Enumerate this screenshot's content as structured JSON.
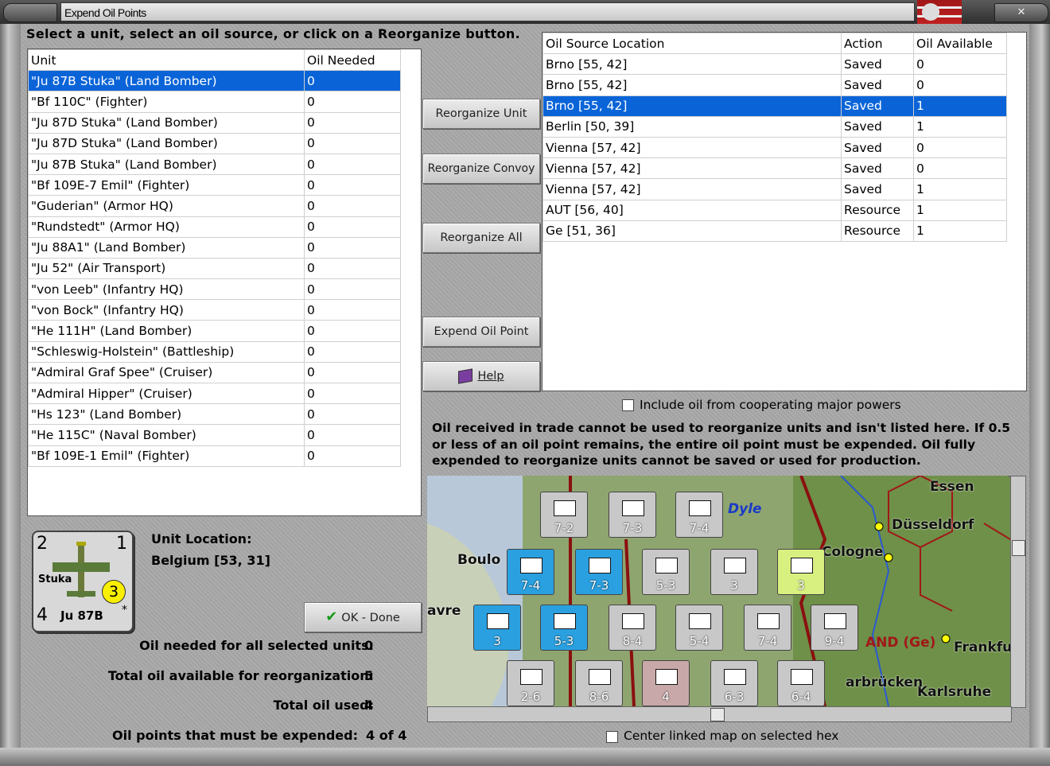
{
  "window": {
    "title": "Expend Oil Points"
  },
  "instruction": "Select a unit, select an oil source, or click on a Reorganize button.",
  "unit_table": {
    "columns": [
      "Unit",
      "Oil Needed"
    ],
    "rows": [
      {
        "unit": "\"Ju 87B Stuka\" (Land Bomber)",
        "oil": "0",
        "selected": true
      },
      {
        "unit": "\"Bf 110C\" (Fighter)",
        "oil": "0"
      },
      {
        "unit": "\"Ju 87D Stuka\" (Land Bomber)",
        "oil": "0"
      },
      {
        "unit": "\"Ju 87D Stuka\" (Land Bomber)",
        "oil": "0"
      },
      {
        "unit": "\"Ju 87B Stuka\" (Land Bomber)",
        "oil": "0"
      },
      {
        "unit": "\"Bf 109E-7 Emil\" (Fighter)",
        "oil": "0"
      },
      {
        "unit": "\"Guderian\" (Armor HQ)",
        "oil": "0"
      },
      {
        "unit": "\"Rundstedt\" (Armor HQ)",
        "oil": "0"
      },
      {
        "unit": "\"Ju 88A1\" (Land Bomber)",
        "oil": "0"
      },
      {
        "unit": "\"Ju 52\" (Air Transport)",
        "oil": "0"
      },
      {
        "unit": "\"von Leeb\" (Infantry HQ)",
        "oil": "0"
      },
      {
        "unit": "\"von Bock\" (Infantry HQ)",
        "oil": "0"
      },
      {
        "unit": "\"He 111H\" (Land Bomber)",
        "oil": "0"
      },
      {
        "unit": "\"Schleswig-Holstein\" (Battleship)",
        "oil": "0"
      },
      {
        "unit": "\"Admiral Graf Spee\" (Cruiser)",
        "oil": "0"
      },
      {
        "unit": "\"Admiral Hipper\" (Cruiser)",
        "oil": "0"
      },
      {
        "unit": "\"Hs 123\" (Land Bomber)",
        "oil": "0"
      },
      {
        "unit": "\"He 115C\" (Naval Bomber)",
        "oil": "0"
      },
      {
        "unit": "\"Bf 109E-1 Emil\" (Fighter)",
        "oil": "0"
      }
    ]
  },
  "oil_table": {
    "columns": [
      "Oil Source Location",
      "Action",
      "Oil Available"
    ],
    "rows": [
      {
        "location": "Brno [55, 42]",
        "action": "Saved",
        "available": "0"
      },
      {
        "location": "Brno [55, 42]",
        "action": "Saved",
        "available": "0"
      },
      {
        "location": "Brno [55, 42]",
        "action": "Saved",
        "available": "1",
        "selected": true
      },
      {
        "location": "Berlin [50, 39]",
        "action": "Saved",
        "available": "1"
      },
      {
        "location": "Vienna [57, 42]",
        "action": "Saved",
        "available": "0"
      },
      {
        "location": "Vienna [57, 42]",
        "action": "Saved",
        "available": "0"
      },
      {
        "location": "Vienna [57, 42]",
        "action": "Saved",
        "available": "1"
      },
      {
        "location": "AUT [56, 40]",
        "action": "Resource",
        "available": "1"
      },
      {
        "location": "Ge [51, 36]",
        "action": "Resource",
        "available": "1"
      }
    ]
  },
  "buttons": {
    "reorganize_unit": "Reorganize Unit",
    "reorganize_convoy": "Reorganize Convoy",
    "reorganize_all": "Reorganize All",
    "expend_oil_point": "Expend Oil Point",
    "help": "Help",
    "ok_done": "OK - Done"
  },
  "include_coop_label": "Include oil from cooperating major powers",
  "note": "Oil received in trade cannot be used to reorganize units and isn't listed here.  If 0.5 or less of an oil point remains, the entire oil point must be expended.  Oil fully expended to reorganize units cannot be saved or used for production.",
  "unit_counter": {
    "top_left": "2",
    "top_right": "1",
    "name": "Stuka",
    "circle": "3",
    "bottom_left": "4",
    "model": "Ju 87B",
    "star": "*"
  },
  "unit_location": {
    "label": "Unit Location:",
    "value": "Belgium [53, 31]"
  },
  "summary": [
    {
      "label": "Oil needed for all selected units:",
      "value": "0"
    },
    {
      "label": "Total oil available for reorganization:",
      "value": "5"
    },
    {
      "label": "Total oil used:",
      "value": "4"
    },
    {
      "label": "Oil points that must be expended:",
      "value": "4 of 4"
    }
  ],
  "map": {
    "cities": [
      "Essen",
      "Düsseldorf",
      "Cologne",
      "Frankfu",
      "Karlsruhe",
      "arbrücken",
      "Boulo",
      "avre"
    ],
    "region_label": "AND (Ge)",
    "river_label": "Dyle",
    "counters": [
      {
        "value": "7-2",
        "color": "#c8c8c8"
      },
      {
        "value": "7-3",
        "color": "#c8c8c8"
      },
      {
        "value": "7-4",
        "color": "#c8c8c8"
      },
      {
        "value": "7-4",
        "color": "#2aa0e0"
      },
      {
        "value": "7-3",
        "color": "#2aa0e0"
      },
      {
        "value": "5-3",
        "color": "#c8c8c8"
      },
      {
        "value": "3",
        "color": "#c8c8c8"
      },
      {
        "value": "3",
        "color": "#d8f080"
      },
      {
        "value": "3",
        "color": "#2aa0e0"
      },
      {
        "value": "5-3",
        "color": "#2aa0e0"
      },
      {
        "value": "8-4",
        "color": "#c8c8c8"
      },
      {
        "value": "5-4",
        "color": "#c8c8c8"
      },
      {
        "value": "7-4",
        "color": "#c8c8c8"
      },
      {
        "value": "9-4",
        "color": "#c8c8c8"
      },
      {
        "value": "2-6",
        "color": "#c8c8c8"
      },
      {
        "value": "8-6",
        "color": "#c8c8c8"
      },
      {
        "value": "4",
        "color": "#c8a8a8"
      },
      {
        "value": "6-3",
        "color": "#c8c8c8"
      },
      {
        "value": "6-4",
        "color": "#c8c8c8"
      }
    ]
  },
  "center_map_label": "Center linked map on selected hex"
}
